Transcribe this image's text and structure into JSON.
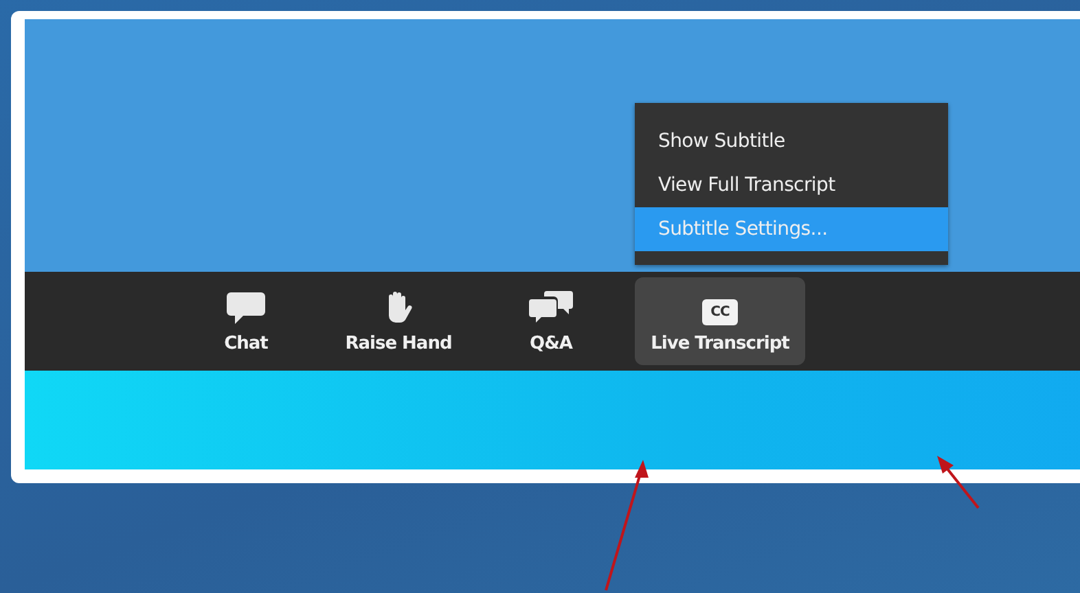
{
  "menu": {
    "items": [
      {
        "label": "Show Subtitle",
        "selected": false
      },
      {
        "label": "View Full Transcript",
        "selected": false
      },
      {
        "label": "Subtitle Settings...",
        "selected": true
      }
    ]
  },
  "toolbar": {
    "items": [
      {
        "kind": "chat",
        "label": "Chat",
        "selected": false
      },
      {
        "kind": "hand",
        "label": "Raise Hand",
        "selected": false
      },
      {
        "kind": "qa",
        "label": "Q&A",
        "selected": false
      },
      {
        "kind": "cc",
        "badge": "CC",
        "label": "Live Transcript",
        "selected": true
      }
    ]
  }
}
